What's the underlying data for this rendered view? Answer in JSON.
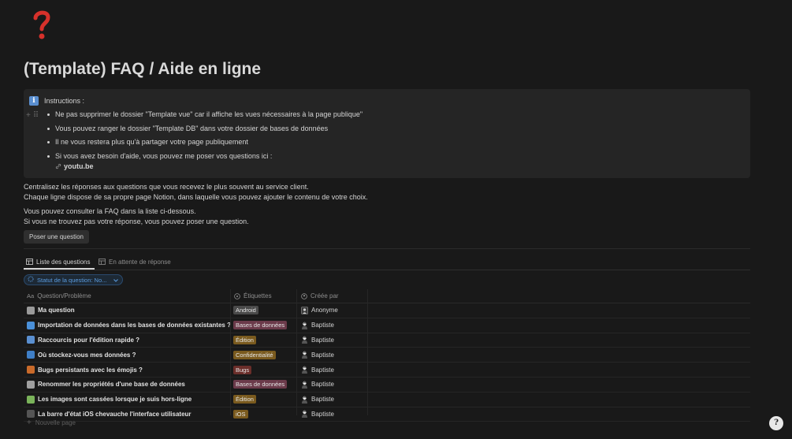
{
  "page": {
    "icon": "red-question-mark-icon",
    "title": "(Template) FAQ / Aide en ligne"
  },
  "callout": {
    "icon": "info-icon",
    "icon_glyph": "i",
    "heading": "Instructions :",
    "bullets": [
      "Ne pas supprimer le dossier \"Template vue\" car il affiche les vues nécessaires à la page publique\"",
      "Vous pouvez ranger le dossier \"Template DB\" dans votre dossier de bases de données",
      "Il ne vous restera plus qu'à partager votre page publiquement",
      "Si vous avez besoin d'aide, vous pouvez me poser vos questions ici :"
    ],
    "link_text": "youtu.be"
  },
  "intro": {
    "line1": "Centralisez les réponses aux questions que vous recevez le plus souvent au service client.",
    "line2": "Chaque ligne dispose de sa propre page Notion, dans laquelle vous pouvez ajouter le contenu de votre choix.",
    "line3": "Vous pouvez consulter la FAQ dans la liste ci-dessous.",
    "line4": "Si vous ne trouvez pas votre réponse, vous pouvez poser une question."
  },
  "ask_button": "Poser une question",
  "tabs": [
    {
      "label": "Liste des questions",
      "active": true
    },
    {
      "label": "En attente de réponse",
      "active": false
    }
  ],
  "filter": {
    "label": "Statut de la question: No...",
    "accent": "#5a9bde"
  },
  "table": {
    "columns": [
      {
        "label": "Question/Problème",
        "icon_text": "Aa"
      },
      {
        "label": "Étiquettes",
        "icon": "tag-circle-icon"
      },
      {
        "label": "Créée par",
        "icon": "person-circle-icon"
      }
    ],
    "rows": [
      {
        "name": "Ma question",
        "icon": "page-icon",
        "icon_color": "#9a9a9a",
        "tag": "Android",
        "tag_color": "#4a4a4a",
        "creator": "Anonyme",
        "avatar": "anonymous-avatar"
      },
      {
        "name": "Importation de données dans les bases de données existantes ?",
        "icon": "inbox-tray-icon",
        "icon_color": "#4a90d9",
        "tag": "Bases de données",
        "tag_color": "#6b3a4a",
        "creator": "Baptiste",
        "avatar": "person-avatar"
      },
      {
        "name": "Raccourcis pour l'édition rapide ?",
        "icon": "keyboard-key-icon",
        "icon_color": "#5a8fd0",
        "tag": "Édition",
        "tag_color": "#7a5a1e",
        "creator": "Baptiste",
        "avatar": "person-avatar"
      },
      {
        "name": "Où stockez-vous mes données ?",
        "icon": "globe-icon",
        "icon_color": "#3f7fc7",
        "tag": "Confidentialité",
        "tag_color": "#7a5a1e",
        "creator": "Baptiste",
        "avatar": "person-avatar"
      },
      {
        "name": "Bugs persistants avec les émojis ?",
        "icon": "bug-icon",
        "icon_color": "#c96a2a",
        "tag": "Bugs",
        "tag_color": "#6b2e2a",
        "creator": "Baptiste",
        "avatar": "person-avatar"
      },
      {
        "name": "Renommer les propriétés d'une base de données",
        "icon": "gear-icon",
        "icon_color": "#a0a0a0",
        "tag": "Bases de données",
        "tag_color": "#6b3a4a",
        "creator": "Baptiste",
        "avatar": "person-avatar"
      },
      {
        "name": "Les images sont cassées lorsque je suis hors-ligne",
        "icon": "picture-icon",
        "icon_color": "#7ab35a",
        "tag": "Édition",
        "tag_color": "#7a5a1e",
        "creator": "Baptiste",
        "avatar": "person-avatar"
      },
      {
        "name": "La barre d'état iOS chevauche l'interface utilisateur",
        "icon": "mobile-phone-icon",
        "icon_color": "#555555",
        "tag": "iOS",
        "tag_color": "#7a5a1e",
        "creator": "Baptiste",
        "avatar": "person-avatar"
      }
    ]
  },
  "new_page": "Nouvelle page",
  "help_glyph": "?"
}
